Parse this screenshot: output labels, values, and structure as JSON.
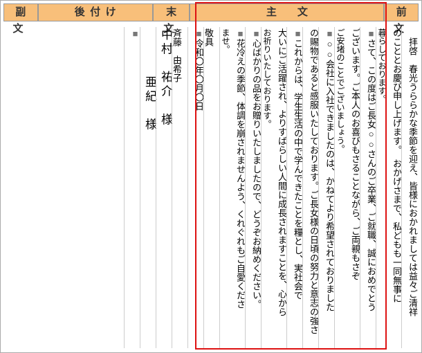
{
  "headers": {
    "fukubun": "副文",
    "atozuke": "後付け",
    "matsubun": "末文",
    "shubun": "主　文",
    "zenbun": "前 文"
  },
  "cols": {
    "c1": "　拝啓　春光うららかな季節を迎え、皆様におかれましては益々ご清祥",
    "c2": "のこととお慶び申し上げます。　おかげさまで、私どもも一同無事に",
    "c3": "暮らしております。",
    "c4s": "■",
    "c4": "さて、この度はご長女○○さんのご卒業、ご就職、誠におめでとう",
    "c5": "ございます。ご本人のお喜びもさることながら、ご両親もさぞ",
    "c6": "ご安堵のことでございましょう。",
    "c7s": "■",
    "c7": "○○会社に入社できましたのは、かねてより希望されておりました",
    "c8": "の賜物であると感服いたしております。ご長女様の日頃の努力と意志の強さ",
    "c9s": "■",
    "c9": "これからは、学生生活の中で学んできたことを糧とし、実社会で",
    "c10": "大いにご活躍され、よりすばらしい人間に成長されますことを、心から",
    "c11": "お祈りいたしております。",
    "c12s": "■",
    "c12": "心ばかりの品をお贈りいたしましたので、どうぞお納めください。",
    "c13s": "■",
    "c13": "花冷えの季節、体調を崩されませんよう、くれぐれもご自愛くださ",
    "c14": "ませ。",
    "c15": "敬具",
    "c16s": "■",
    "c16": "令和〇年〇月〇日",
    "c17": "斉藤　由希子",
    "c18": "中村　祐介　様",
    "c19": "　亜紀　様",
    "c20s": "■"
  }
}
